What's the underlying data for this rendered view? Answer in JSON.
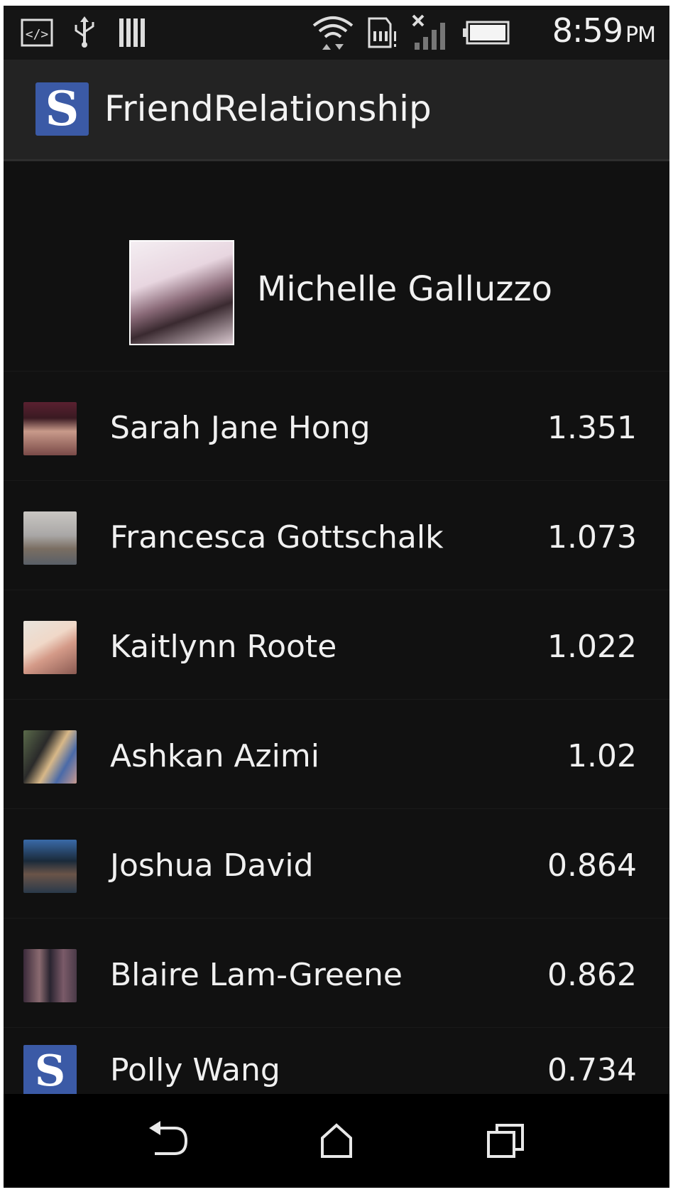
{
  "status_bar": {
    "time": "8:59",
    "ampm": "PM",
    "icons": [
      "code-icon",
      "usb-icon",
      "barcode-icon",
      "wifi-icon",
      "sd-card-icon",
      "no-signal-icon",
      "battery-icon"
    ]
  },
  "action_bar": {
    "logo_letter": "S",
    "title": "FriendRelationship"
  },
  "profile": {
    "name": "Michelle Galluzzo"
  },
  "friends": [
    {
      "name": "Sarah Jane Hong",
      "score": "1.351"
    },
    {
      "name": "Francesca Gottschalk",
      "score": "1.073"
    },
    {
      "name": "Kaitlynn Roote",
      "score": "1.022"
    },
    {
      "name": "Ashkan Azimi",
      "score": "1.02"
    },
    {
      "name": "Joshua David",
      "score": "0.864"
    },
    {
      "name": "Blaire Lam-Greene",
      "score": "0.862"
    },
    {
      "name": "Polly Wang",
      "score": "0.734",
      "avatar_letter": "S"
    }
  ],
  "nav_bar": {
    "icons": [
      "back-icon",
      "home-icon",
      "recent-apps-icon"
    ]
  },
  "colors": {
    "background": "#111111",
    "action_bar": "#232323",
    "logo_blue": "#3b5aa6",
    "text": "#f0f0f0"
  }
}
